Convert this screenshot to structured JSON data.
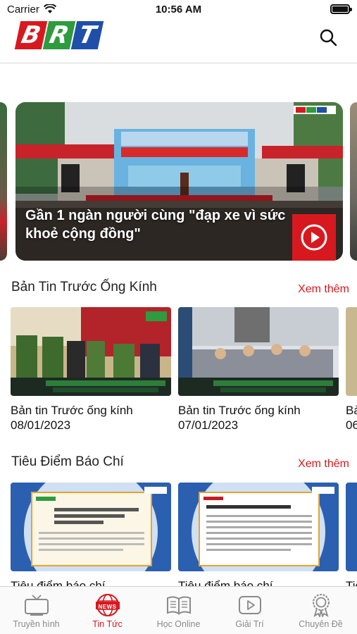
{
  "status_bar": {
    "carrier": "Carrier",
    "time": "10:56 AM"
  },
  "header": {
    "logo_letters": [
      "B",
      "R",
      "T"
    ],
    "logo_colors": [
      "#d7191f",
      "#2e9b3e",
      "#1f4fa8"
    ]
  },
  "hero": {
    "title": "Gần 1 ngàn người cùng \"đạp xe vì sức khoẻ cộng đồng\""
  },
  "sections": [
    {
      "title": "Bản Tin Trước Ống Kính",
      "see_more": "Xem thêm",
      "items": [
        {
          "line1": "Bản tin Trước ống kính",
          "line2": "08/01/2023"
        },
        {
          "line1": "Bản tin Trước ống kính",
          "line2": "07/01/2023"
        },
        {
          "line1": "Bả",
          "line2": "06"
        }
      ]
    },
    {
      "title": "Tiêu Điểm Báo Chí",
      "see_more": "Xem thêm",
      "items": [
        {
          "line1": "Tiêu điểm báo chí"
        },
        {
          "line1": "Tiêu điểm báo chí"
        },
        {
          "line1": "Tiê"
        }
      ]
    }
  ],
  "tabbar": {
    "active_index": 1,
    "active_color": "#d7191f",
    "items": [
      {
        "label": "Truyền hình",
        "icon": "tv-icon"
      },
      {
        "label": "Tin Tức",
        "icon": "news-icon",
        "badge": "NEWS"
      },
      {
        "label": "Học Online",
        "icon": "book-icon"
      },
      {
        "label": "Giải Trí",
        "icon": "play-icon"
      },
      {
        "label": "Chuyên Đề",
        "icon": "award-icon"
      }
    ]
  }
}
